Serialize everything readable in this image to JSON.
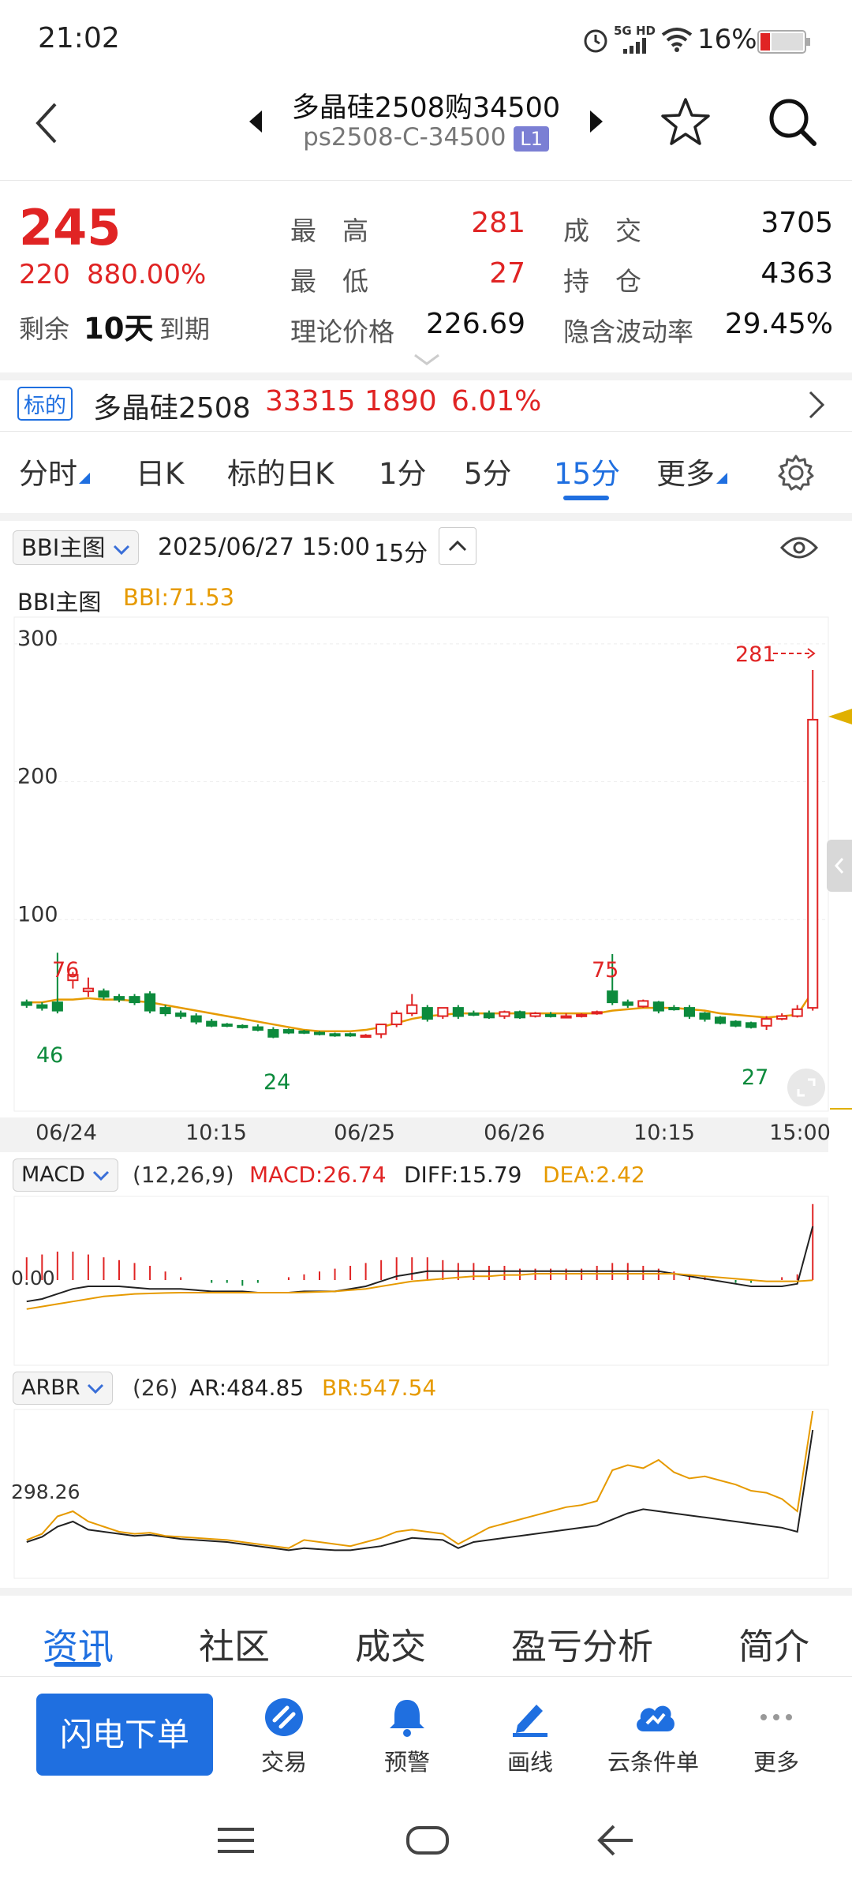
{
  "status_bar": {
    "time": "21:02",
    "network": "5G HD",
    "battery": "16%"
  },
  "header": {
    "title": "多晶硅2508购34500",
    "subtitle": "ps2508-C-34500",
    "level_badge": "L1"
  },
  "quote": {
    "last_price": "245",
    "change": "220",
    "change_pct": "880.00%",
    "remaining_label": "剩余",
    "remaining_value": "10天",
    "expiry_label": "到期",
    "high_label": "最　高",
    "high_value": "281",
    "low_label": "最　低",
    "low_value": "27",
    "theory_label": "理论价格",
    "theory_value": "226.69",
    "volume_label": "成　交",
    "volume_value": "3705",
    "oi_label": "持　仓",
    "oi_value": "4363",
    "iv_label": "隐含波动率",
    "iv_value": "29.45%"
  },
  "underlying": {
    "tag": "标的",
    "name": "多晶硅2508",
    "price": "33315",
    "change": "1890",
    "change_pct": "6.01%"
  },
  "period_tabs": [
    "分时",
    "日K",
    "标的日K",
    "1分",
    "5分",
    "15分",
    "更多"
  ],
  "period_active": "15分",
  "chart_toolbar": {
    "indicator": "BBI主图",
    "datetime": "2025/06/27 15:00",
    "period": "15分"
  },
  "main_chart": {
    "legend_name": "BBI主图",
    "legend_value": "BBI:71.53",
    "y_ticks": [
      "300",
      "200",
      "100"
    ],
    "x_ticks": [
      "06/24",
      "10:15",
      "06/25",
      "06/26",
      "10:15",
      "15:00"
    ],
    "annotations": {
      "max_label": "281",
      "peak1": "76",
      "peak2": "75",
      "low1": "46",
      "low2": "24",
      "low3": "27"
    }
  },
  "macd_panel": {
    "name": "MACD",
    "params": "(12,26,9)",
    "macd": "MACD:26.74",
    "diff": "DIFF:15.79",
    "dea": "DEA:2.42",
    "zero_label": "0.00"
  },
  "arbr_panel": {
    "name": "ARBR",
    "params": "(26)",
    "ar": "AR:484.85",
    "br": "BR:547.54",
    "level_label": "298.26"
  },
  "colors": {
    "up": "#e02424",
    "down": "#0c8a3c",
    "accent": "#1f6fe0",
    "bbi": "#e69a00"
  },
  "chart_data": {
    "type": "candlestick",
    "period": "15分",
    "ylim": [
      0,
      300
    ],
    "x_ticks": [
      "06/24",
      "10:15",
      "06/25",
      "06/26",
      "10:15",
      "15:00"
    ],
    "candles": [
      {
        "o": 40,
        "h": 42,
        "c": 38,
        "l": 36
      },
      {
        "o": 38,
        "h": 40,
        "c": 36,
        "l": 34
      },
      {
        "o": 40,
        "h": 76,
        "c": 34,
        "l": 32
      },
      {
        "o": 56,
        "h": 62,
        "c": 60,
        "l": 50
      },
      {
        "o": 48,
        "h": 58,
        "c": 50,
        "l": 44
      },
      {
        "o": 48,
        "h": 50,
        "c": 44,
        "l": 42
      },
      {
        "o": 44,
        "h": 46,
        "c": 42,
        "l": 40
      },
      {
        "o": 44,
        "h": 46,
        "c": 40,
        "l": 38
      },
      {
        "o": 46,
        "h": 48,
        "c": 34,
        "l": 32
      },
      {
        "o": 36,
        "h": 38,
        "c": 32,
        "l": 30
      },
      {
        "o": 32,
        "h": 34,
        "c": 30,
        "l": 28
      },
      {
        "o": 30,
        "h": 32,
        "c": 26,
        "l": 24
      },
      {
        "o": 26,
        "h": 28,
        "c": 23,
        "l": 22
      },
      {
        "o": 24,
        "h": 25,
        "c": 23,
        "l": 22
      },
      {
        "o": 23,
        "h": 24,
        "c": 22,
        "l": 21
      },
      {
        "o": 22,
        "h": 24,
        "c": 20,
        "l": 19
      },
      {
        "o": 20,
        "h": 22,
        "c": 15,
        "l": 14
      },
      {
        "o": 20,
        "h": 21,
        "c": 18,
        "l": 17
      },
      {
        "o": 19,
        "h": 20,
        "c": 18,
        "l": 17
      },
      {
        "o": 18,
        "h": 19,
        "c": 17,
        "l": 16
      },
      {
        "o": 17,
        "h": 18,
        "c": 16,
        "l": 15
      },
      {
        "o": 17,
        "h": 18,
        "c": 16,
        "l": 15
      },
      {
        "o": 16,
        "h": 17,
        "c": 16,
        "l": 15
      },
      {
        "o": 17,
        "h": 24,
        "c": 24,
        "l": 14
      },
      {
        "o": 24,
        "h": 34,
        "c": 32,
        "l": 22
      },
      {
        "o": 32,
        "h": 46,
        "c": 38,
        "l": 30
      },
      {
        "o": 36,
        "h": 38,
        "c": 28,
        "l": 26
      },
      {
        "o": 30,
        "h": 36,
        "c": 36,
        "l": 28
      },
      {
        "o": 36,
        "h": 38,
        "c": 30,
        "l": 28
      },
      {
        "o": 32,
        "h": 34,
        "c": 31,
        "l": 30
      },
      {
        "o": 32,
        "h": 34,
        "c": 29,
        "l": 28
      },
      {
        "o": 30,
        "h": 34,
        "c": 33,
        "l": 28
      },
      {
        "o": 33,
        "h": 34,
        "c": 29,
        "l": 28
      },
      {
        "o": 30,
        "h": 33,
        "c": 32,
        "l": 29
      },
      {
        "o": 31,
        "h": 33,
        "c": 30,
        "l": 29
      },
      {
        "o": 30,
        "h": 32,
        "c": 30,
        "l": 29
      },
      {
        "o": 30,
        "h": 32,
        "c": 31,
        "l": 29
      },
      {
        "o": 32,
        "h": 34,
        "c": 33,
        "l": 31
      },
      {
        "o": 48,
        "h": 75,
        "c": 40,
        "l": 38
      },
      {
        "o": 40,
        "h": 42,
        "c": 38,
        "l": 36
      },
      {
        "o": 37,
        "h": 42,
        "c": 41,
        "l": 36
      },
      {
        "o": 40,
        "h": 41,
        "c": 34,
        "l": 32
      },
      {
        "o": 36,
        "h": 38,
        "c": 35,
        "l": 34
      },
      {
        "o": 36,
        "h": 38,
        "c": 30,
        "l": 28
      },
      {
        "o": 32,
        "h": 33,
        "c": 28,
        "l": 26
      },
      {
        "o": 29,
        "h": 30,
        "c": 25,
        "l": 24
      },
      {
        "o": 26,
        "h": 27,
        "c": 23,
        "l": 22
      },
      {
        "o": 25,
        "h": 26,
        "c": 22,
        "l": 21
      },
      {
        "o": 23,
        "h": 30,
        "c": 28,
        "l": 20
      },
      {
        "o": 28,
        "h": 32,
        "c": 30,
        "l": 27
      },
      {
        "o": 30,
        "h": 38,
        "c": 35,
        "l": 29
      },
      {
        "o": 36,
        "h": 281,
        "c": 245,
        "l": 34
      }
    ],
    "bbi": [
      40,
      40,
      42,
      42,
      43,
      42,
      42,
      41,
      40,
      38,
      36,
      34,
      32,
      30,
      28,
      26,
      24,
      22,
      20,
      19,
      19,
      19,
      20,
      22,
      25,
      28,
      30,
      31,
      32,
      32,
      32,
      32,
      32,
      32,
      32,
      32,
      32,
      32,
      34,
      35,
      36,
      36,
      36,
      35,
      34,
      32,
      31,
      30,
      29,
      30,
      31,
      48
    ],
    "macd_hist": [
      8,
      9,
      10,
      10,
      9,
      8,
      7,
      6,
      5,
      3,
      1,
      0,
      -1,
      -1,
      -2,
      -1,
      0,
      1,
      2,
      3,
      4,
      5,
      6,
      7,
      8,
      8,
      8,
      7,
      6,
      6,
      5,
      5,
      4,
      4,
      4,
      4,
      4,
      5,
      6,
      6,
      5,
      4,
      3,
      2,
      1,
      0,
      -1,
      -1,
      0,
      1,
      2,
      26.74
    ],
    "macd_diff": [
      -6,
      -5,
      -3,
      -1,
      0,
      0,
      0,
      -0.5,
      -1,
      -1,
      -1,
      -1.5,
      -2,
      -2,
      -2,
      -2.5,
      -2.5,
      -2.5,
      -2,
      -2,
      -2,
      -1,
      0,
      2,
      4,
      5,
      6,
      6,
      6,
      6,
      6,
      6,
      6,
      6,
      6,
      6,
      6,
      6,
      6,
      6,
      6,
      6,
      5,
      4,
      3,
      2,
      1,
      0,
      0,
      0,
      1,
      15.79
    ],
    "macd_dea": [
      -9,
      -8,
      -7,
      -6,
      -5,
      -4,
      -3.5,
      -3,
      -2.8,
      -2.6,
      -2.5,
      -2.5,
      -2.5,
      -2.5,
      -2.5,
      -2.5,
      -2.5,
      -2.5,
      -2.4,
      -2.2,
      -2,
      -1.5,
      -1,
      0,
      1,
      2,
      2.5,
      3,
      3.5,
      4,
      4,
      4.5,
      4.5,
      5,
      5,
      5,
      5,
      5,
      5,
      5,
      5,
      5,
      5,
      4.5,
      4,
      3.5,
      3,
      2.5,
      2,
      2,
      2,
      2.42
    ],
    "ar": [
      20,
      25,
      35,
      40,
      32,
      30,
      28,
      26,
      27,
      25,
      23,
      22,
      21,
      20,
      18,
      16,
      14,
      12,
      14,
      13,
      12,
      12,
      14,
      16,
      20,
      24,
      23,
      22,
      14,
      20,
      22,
      24,
      26,
      28,
      30,
      32,
      34,
      36,
      42,
      48,
      52,
      50,
      48,
      46,
      44,
      42,
      40,
      38,
      36,
      34,
      30,
      484.85
    ],
    "br": [
      22,
      28,
      45,
      50,
      40,
      35,
      30,
      28,
      29,
      26,
      25,
      24,
      23,
      22,
      20,
      18,
      16,
      14,
      22,
      20,
      18,
      16,
      20,
      24,
      30,
      32,
      30,
      28,
      18,
      26,
      34,
      38,
      42,
      46,
      50,
      54,
      56,
      60,
      90,
      95,
      92,
      100,
      88,
      82,
      84,
      80,
      76,
      70,
      68,
      62,
      50,
      547.54
    ]
  }
}
